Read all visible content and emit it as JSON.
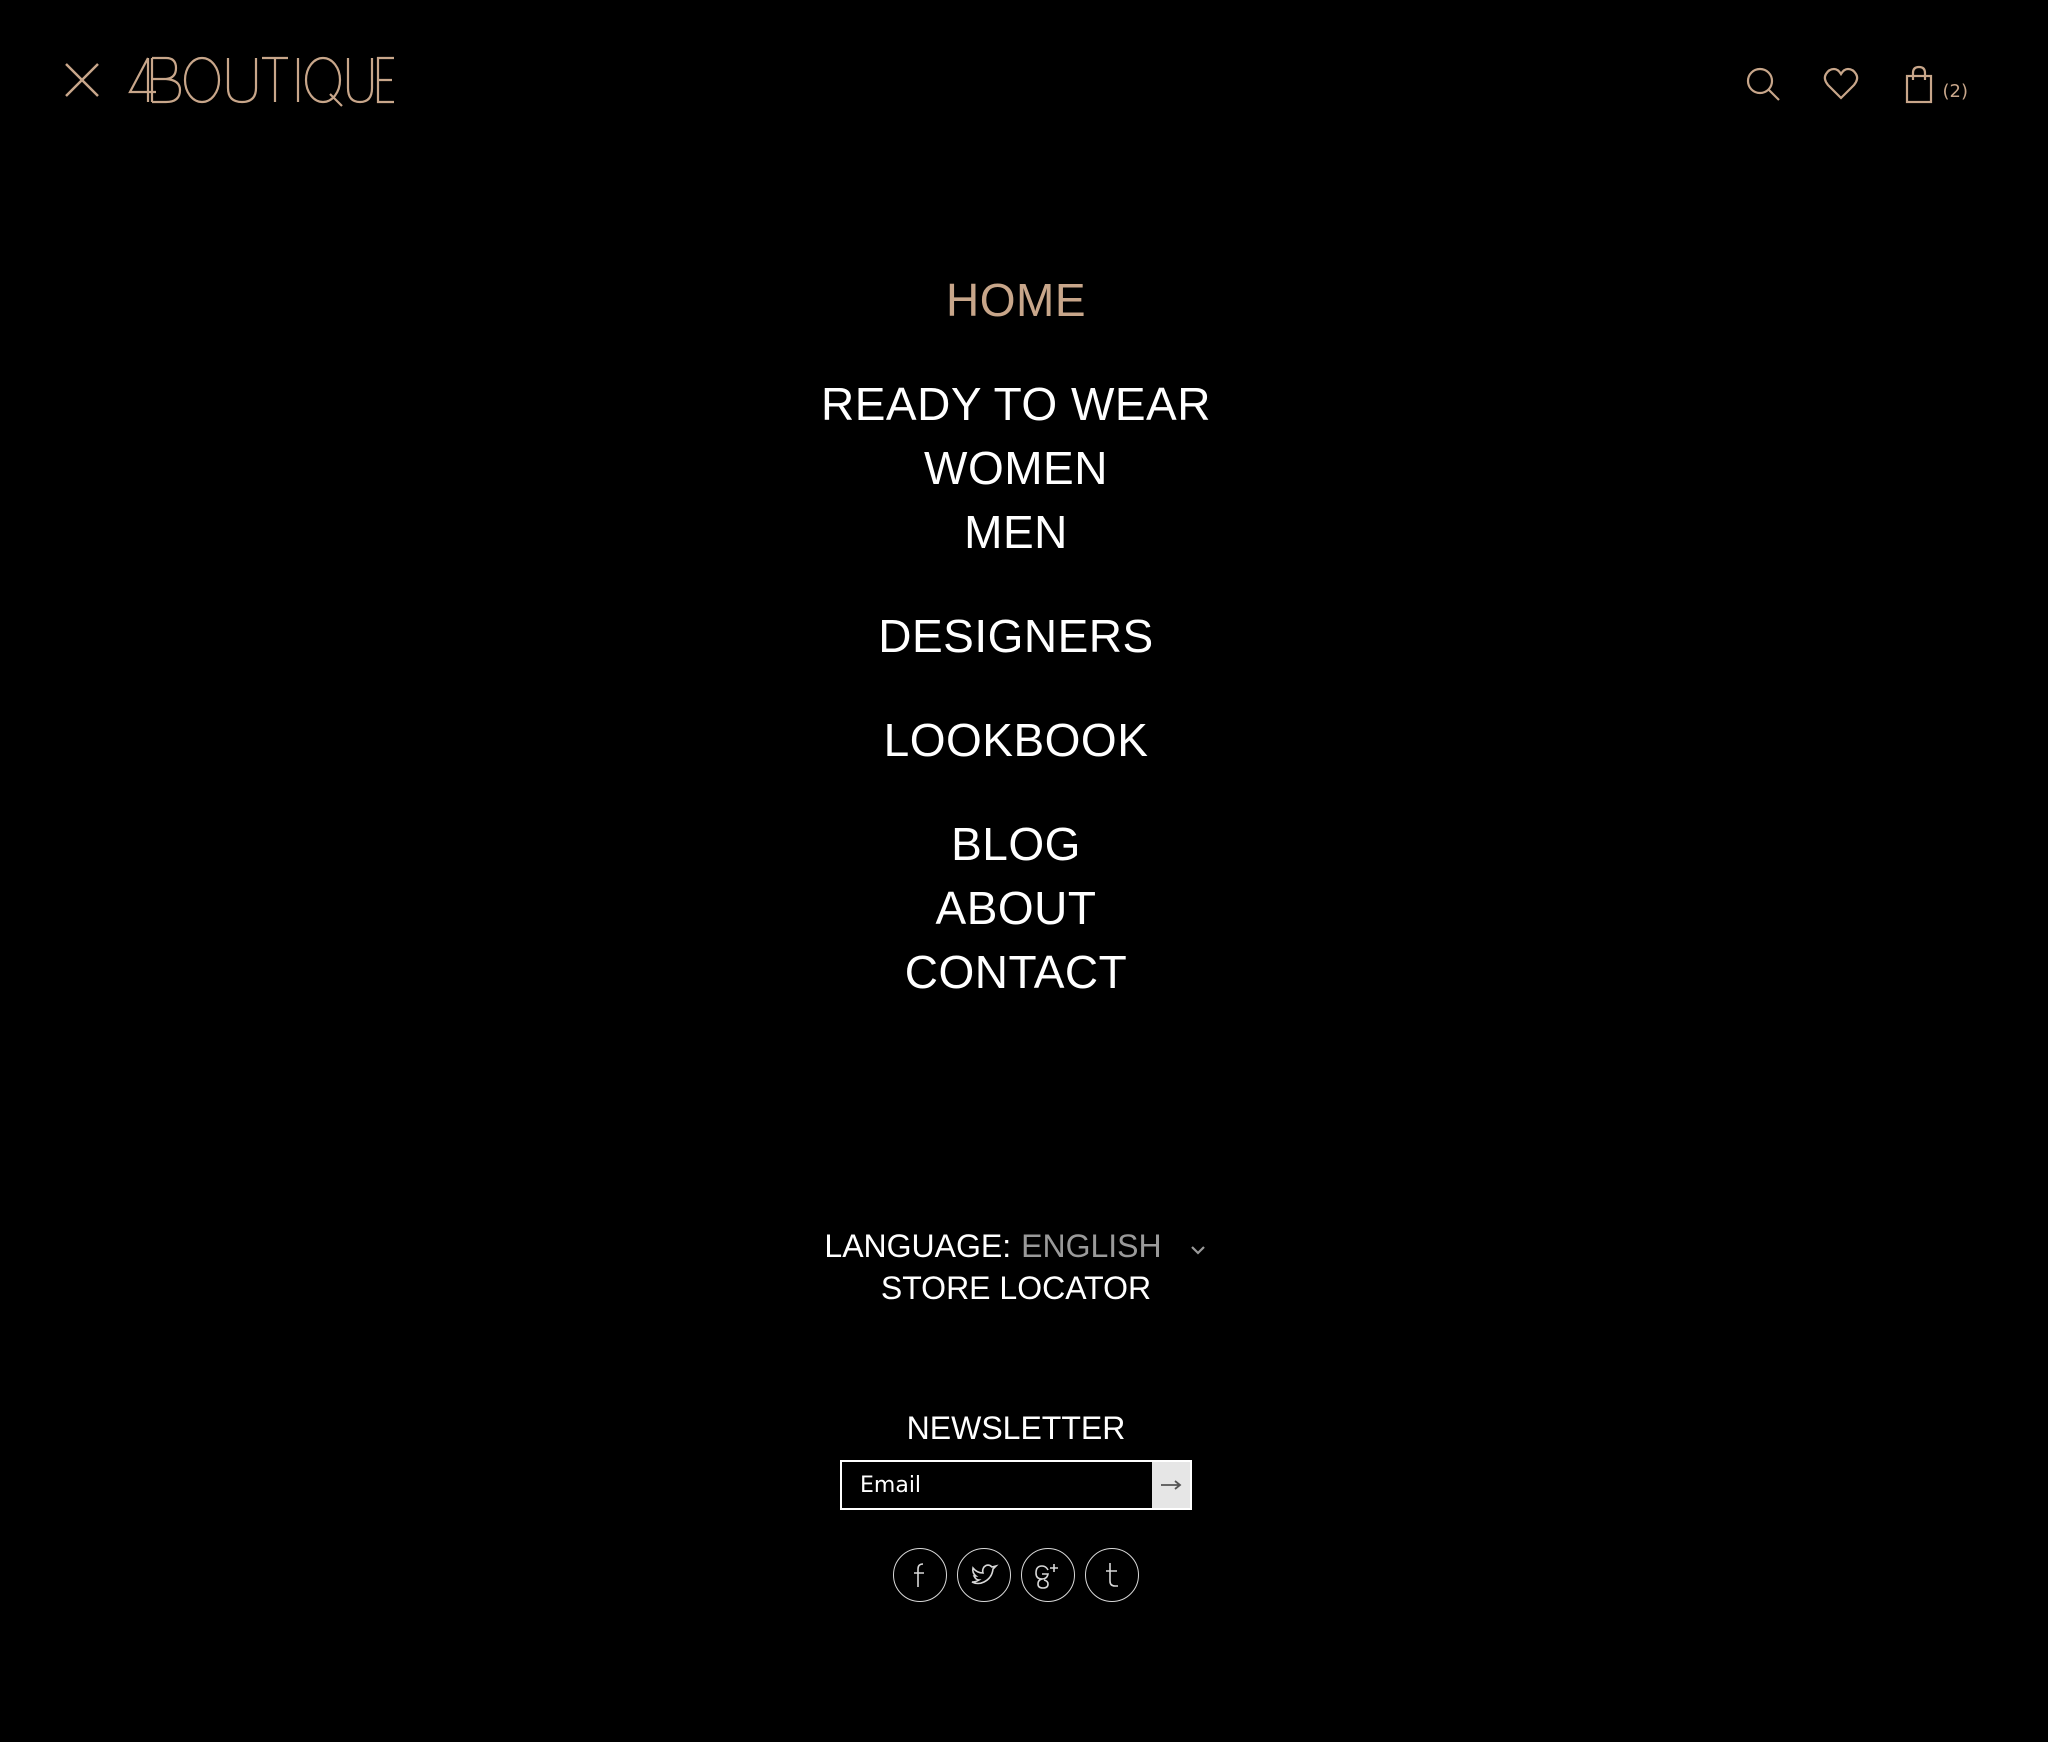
{
  "header": {
    "logo_text": "4BOUTIQUE",
    "cart_count": "(2)"
  },
  "menu": {
    "groups": [
      [
        "HOME"
      ],
      [
        "READY TO WEAR",
        "WOMEN",
        "MEN"
      ],
      [
        "DESIGNERS"
      ],
      [
        "LOOKBOOK"
      ],
      [
        "BLOG",
        "ABOUT",
        "CONTACT"
      ]
    ]
  },
  "utility": {
    "language_label": "LANGUAGE:",
    "language_value": "ENGLISH",
    "store_locator": "STORE LOCATOR"
  },
  "newsletter": {
    "title": "NEWSLETTER",
    "email_placeholder": "Email"
  },
  "social": [
    "facebook-icon",
    "twitter-icon",
    "google-plus-icon",
    "tumblr-icon"
  ],
  "colors": {
    "accent": "#c8a68a",
    "background": "#000000",
    "text": "#ffffff",
    "muted": "#9a9a9a"
  }
}
